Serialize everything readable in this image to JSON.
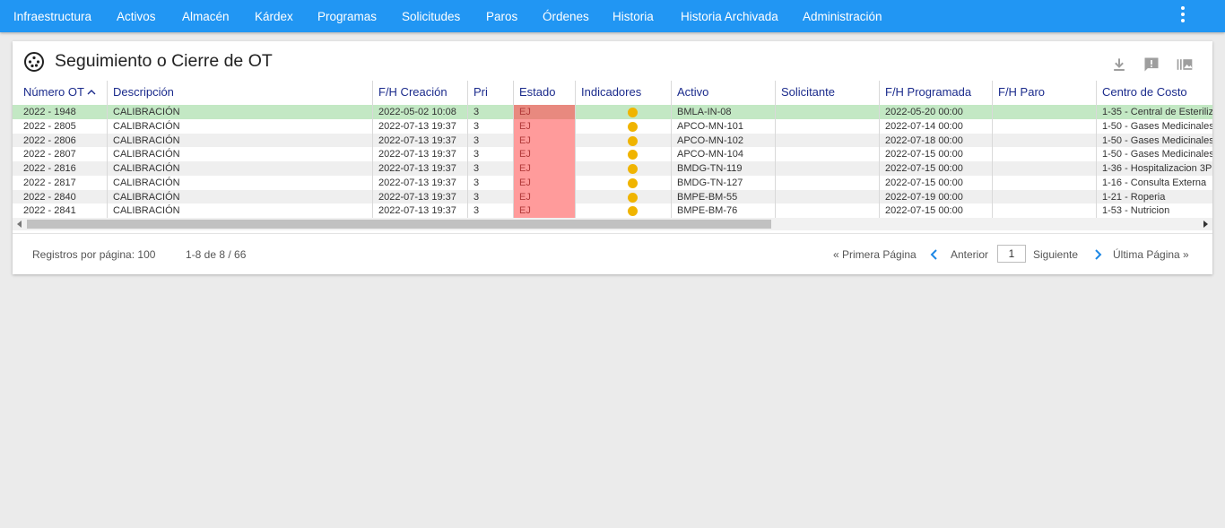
{
  "nav": {
    "items": [
      "Infraestructura",
      "Activos",
      "Almacén",
      "Kárdex",
      "Programas",
      "Solicitudes",
      "Paros",
      "Órdenes",
      "Historia",
      "Historia Archivada",
      "Administración"
    ],
    "more_icon": "more-vert-icon"
  },
  "page": {
    "title": "Seguimiento o Cierre de OT",
    "title_icon": "disc-icon",
    "tools": [
      "download-icon",
      "feedback-icon",
      "gallery-icon"
    ]
  },
  "table": {
    "columns": [
      "Número OT",
      "Descripción",
      "F/H Creación",
      "Pri",
      "Estado",
      "Indicadores",
      "Activo",
      "Solicitante",
      "F/H Programada",
      "F/H Paro",
      "Centro de Costo"
    ],
    "sort_column": "Número OT",
    "sort_direction": "asc",
    "rows": [
      {
        "ot": "2022 - 1948",
        "desc": "CALIBRACIÓN",
        "creacion": "2022-05-02 10:08",
        "pri": "3",
        "estado": "EJ",
        "activo": "BMLA-IN-08",
        "solicitante": "",
        "programada": "2022-05-20 00:00",
        "paro": "",
        "centro": "1-35 - Central de Esteriliz",
        "selected": true
      },
      {
        "ot": "2022 - 2805",
        "desc": "CALIBRACIÓN",
        "creacion": "2022-07-13 19:37",
        "pri": "3",
        "estado": "EJ",
        "activo": "APCO-MN-101",
        "solicitante": "",
        "programada": "2022-07-14 00:00",
        "paro": "",
        "centro": "1-50 - Gases Medicinales"
      },
      {
        "ot": "2022 - 2806",
        "desc": "CALIBRACIÓN",
        "creacion": "2022-07-13 19:37",
        "pri": "3",
        "estado": "EJ",
        "activo": "APCO-MN-102",
        "solicitante": "",
        "programada": "2022-07-18 00:00",
        "paro": "",
        "centro": "1-50 - Gases Medicinales"
      },
      {
        "ot": "2022 - 2807",
        "desc": "CALIBRACIÓN",
        "creacion": "2022-07-13 19:37",
        "pri": "3",
        "estado": "EJ",
        "activo": "APCO-MN-104",
        "solicitante": "",
        "programada": "2022-07-15 00:00",
        "paro": "",
        "centro": "1-50 - Gases Medicinales"
      },
      {
        "ot": "2022 - 2816",
        "desc": "CALIBRACIÓN",
        "creacion": "2022-07-13 19:37",
        "pri": "3",
        "estado": "EJ",
        "activo": "BMDG-TN-119",
        "solicitante": "",
        "programada": "2022-07-15 00:00",
        "paro": "",
        "centro": "1-36 - Hospitalizacion 3P"
      },
      {
        "ot": "2022 - 2817",
        "desc": "CALIBRACIÓN",
        "creacion": "2022-07-13 19:37",
        "pri": "3",
        "estado": "EJ",
        "activo": "BMDG-TN-127",
        "solicitante": "",
        "programada": "2022-07-15 00:00",
        "paro": "",
        "centro": "1-16 - Consulta Externa"
      },
      {
        "ot": "2022 - 2840",
        "desc": "CALIBRACIÓN",
        "creacion": "2022-07-13 19:37",
        "pri": "3",
        "estado": "EJ",
        "activo": "BMPE-BM-55",
        "solicitante": "",
        "programada": "2022-07-19 00:00",
        "paro": "",
        "centro": "1-21 - Roperia"
      },
      {
        "ot": "2022 - 2841",
        "desc": "CALIBRACIÓN",
        "creacion": "2022-07-13 19:37",
        "pri": "3",
        "estado": "EJ",
        "activo": "BMPE-BM-76",
        "solicitante": "",
        "programada": "2022-07-15 00:00",
        "paro": "",
        "centro": "1-53 - Nutricion"
      }
    ]
  },
  "footer": {
    "per_page": "Registros por página: 100",
    "range": "1-8 de 8 / 66",
    "first": "« Primera Página",
    "prev": "Anterior",
    "page": "1",
    "next": "Siguiente",
    "last": "Última Página »"
  },
  "colors": {
    "topbar": "#2196f3",
    "header_text": "#1b2b8c",
    "selected_row": "#c3e8c4",
    "estado_bg": "#ff9b9b",
    "indicator": "#f0b400",
    "link": "#1e88e5"
  }
}
